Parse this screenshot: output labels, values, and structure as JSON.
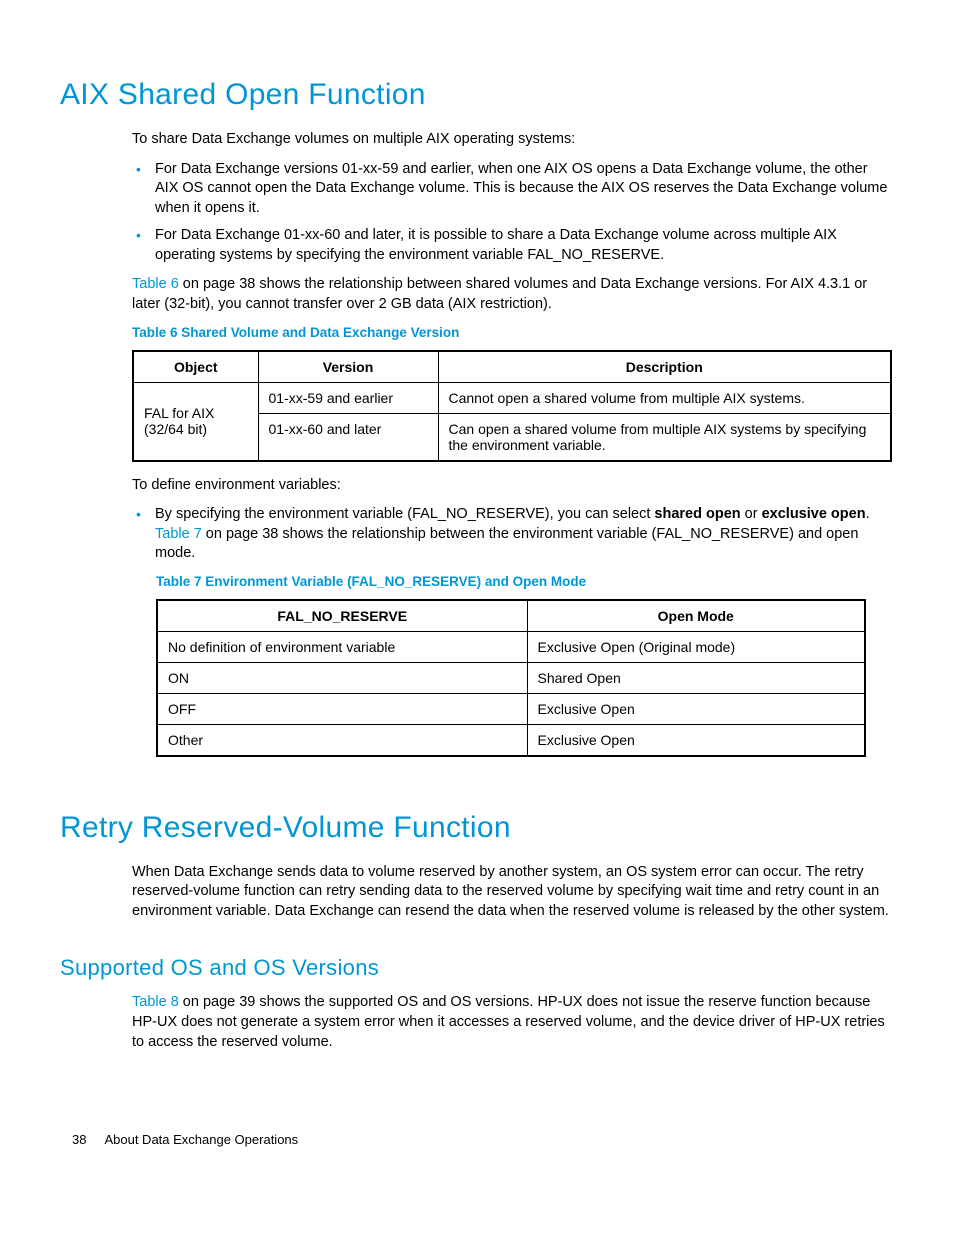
{
  "h1_aix": "AIX Shared Open Function",
  "aix_intro": "To share Data Exchange volumes on multiple AIX operating systems:",
  "aix_bullet1": "For Data Exchange versions 01-xx-59 and earlier, when one AIX OS opens a Data Exchange volume, the other AIX OS cannot open the Data Exchange volume. This is because the AIX OS reserves the Data Exchange volume when it opens it.",
  "aix_bullet2": "For Data Exchange 01-xx-60 and later, it is possible to share a Data Exchange volume across multiple AIX operating systems by specifying the environment variable FAL_NO_RESERVE.",
  "aix_p2_link": "Table 6",
  "aix_p2_rest": " on page 38 shows the relationship between shared volumes and Data Exchange versions. For AIX 4.3.1 or later (32-bit), you cannot transfer over 2 GB data (AIX restriction).",
  "table6_caption": "Table 6 Shared Volume and Data Exchange Version",
  "t6": {
    "h1": "Object",
    "h2": "Version",
    "h3": "Description",
    "r1c1": "FAL for AIX (32/64 bit)",
    "r1c2": "01-xx-59 and earlier",
    "r1c3": "Cannot open a shared volume from multiple AIX systems.",
    "r2c2": "01-xx-60 and later",
    "r2c3": "Can open a shared volume from multiple AIX systems by specifying the environment variable."
  },
  "env_intro": "To define environment variables:",
  "env_b1_pre": "By specifying the environment variable (FAL_NO_RESERVE), you can select ",
  "env_b1_bold1": "shared open",
  "env_b1_mid": " or ",
  "env_b1_bold2": "exclusive open",
  "env_b1_post1": ". ",
  "env_b1_link": "Table 7",
  "env_b1_post2": " on page 38 shows the relationship between the environment variable (FAL_NO_RESERVE) and open mode.",
  "table7_caption": "Table 7 Environment Variable (FAL_NO_RESERVE) and Open Mode",
  "t7": {
    "h1": "FAL_NO_RESERVE",
    "h2": "Open Mode",
    "r1c1": "No definition of environment variable",
    "r1c2": "Exclusive Open (Original mode)",
    "r2c1": "ON",
    "r2c2": "Shared Open",
    "r3c1": "OFF",
    "r3c2": "Exclusive Open",
    "r4c1": "Other",
    "r4c2": "Exclusive Open"
  },
  "h1_retry": "Retry Reserved-Volume Function",
  "retry_p": "When Data Exchange sends data to volume reserved by another system, an OS system error can occur. The retry reserved-volume function can retry sending data to the reserved volume by specifying wait time and retry count in an environment variable. Data Exchange can resend the data when the reserved volume is released by the other system.",
  "h2_supported": "Supported OS and OS Versions",
  "sup_link": "Table 8",
  "sup_rest": " on page 39 shows the supported OS and OS versions. HP-UX does not issue the reserve function because HP-UX does not generate a system error when it accesses a reserved volume, and the device driver of HP-UX retries to access the reserved volume.",
  "footer_page": "38",
  "footer_text": "About Data Exchange Operations"
}
